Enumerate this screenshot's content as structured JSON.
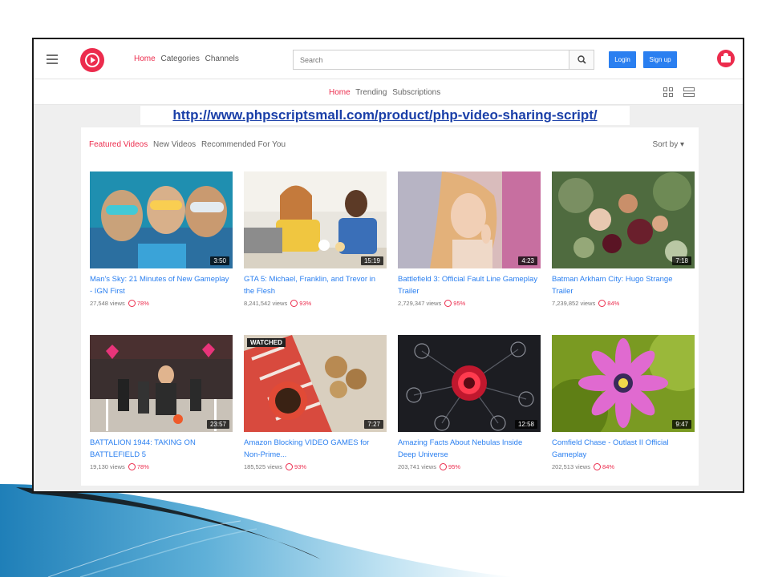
{
  "header": {
    "nav": [
      {
        "label": "Home",
        "active": true
      },
      {
        "label": "Categories",
        "active": false
      },
      {
        "label": "Channels",
        "active": false
      }
    ],
    "search_placeholder": "Search",
    "login_label": "Login",
    "signup_label": "Sign up"
  },
  "subnav": {
    "links": [
      {
        "label": "Home",
        "active": true
      },
      {
        "label": "Trending",
        "active": false
      },
      {
        "label": "Subscriptions",
        "active": false
      }
    ]
  },
  "url_banner": "http://www.phpscriptsmall.com/product/php-video-sharing-script/",
  "content": {
    "tabs": [
      {
        "label": "Featured Videos",
        "active": true
      },
      {
        "label": "New Videos",
        "active": false
      },
      {
        "label": "Recommended For You",
        "active": false
      }
    ],
    "sort_label": "Sort by ▾",
    "videos": [
      {
        "title": "Man's Sky: 21 Minutes of New Gameplay - IGN First",
        "duration": "3:50",
        "views": "27,548 views",
        "rating": "78%",
        "watched": false
      },
      {
        "title": "GTA 5: Michael, Franklin, and Trevor in the Flesh",
        "duration": "15:19",
        "views": "8,241,542 views",
        "rating": "93%",
        "watched": false
      },
      {
        "title": "Battlefield 3: Official Fault Line Gameplay Trailer",
        "duration": "4:23",
        "views": "2,729,347 views",
        "rating": "95%",
        "watched": false
      },
      {
        "title": "Batman Arkham City: Hugo Strange Trailer",
        "duration": "7:18",
        "views": "7,239,852 views",
        "rating": "84%",
        "watched": false
      },
      {
        "title": "BATTALION 1944: TAKING ON BATTLEFIELD 5",
        "duration": "23:57",
        "views": "19,130 views",
        "rating": "78%",
        "watched": false
      },
      {
        "title": "Amazon Blocking VIDEO GAMES for Non-Prime...",
        "duration": "7:27",
        "views": "185,525 views",
        "rating": "93%",
        "watched": true,
        "watched_label": "WATCHED"
      },
      {
        "title": "Amazing Facts About Nebulas Inside Deep Universe",
        "duration": "12:58",
        "views": "203,741 views",
        "rating": "95%",
        "watched": false
      },
      {
        "title": "Comfield Chase - Outlast II Official Gameplay",
        "duration": "9:47",
        "views": "202,513 views",
        "rating": "84%",
        "watched": false
      }
    ]
  },
  "colors": {
    "accent": "#ec2c4d",
    "link": "#2a7ff0",
    "url": "#1a3fa8"
  }
}
